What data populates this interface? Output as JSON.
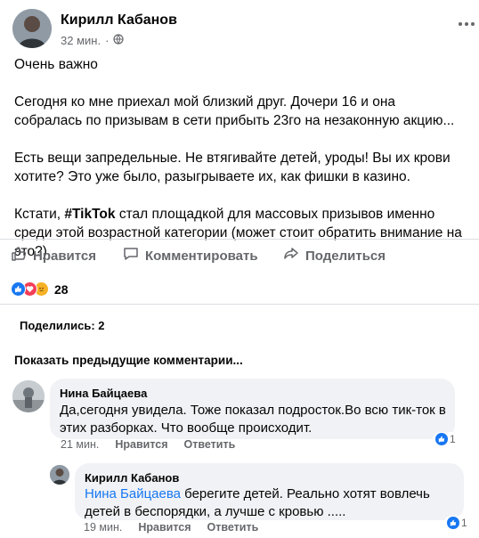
{
  "post": {
    "author": "Кирилл Кабанов",
    "time": "32 мин.",
    "dot": "·",
    "paragraphs": [
      "Очень важно",
      "Сегодня ко мне приехал мой близкий друг. Дочери 16 и она собралась по призывам в сети прибыть 23го на незаконную акцию...",
      "Есть вещи запредельные. Не втягивайте детей, уроды! Вы их крови хотите? Это уже было, разыгрываете их, как фишки в казино."
    ],
    "last_paragraph": {
      "before": "Кстати, ",
      "tag": "#TikTok",
      "after": " стал площадкой для массовых призывов именно среди этой возрастной категории (может стоит обратить внимание на это?)"
    }
  },
  "actions": {
    "like": "Нравится",
    "comment": "Комментировать",
    "share": "Поделиться"
  },
  "reactions": {
    "count": "28",
    "types": [
      "like",
      "love",
      "sad"
    ]
  },
  "shares_text": "Поделились: 2",
  "previous_comments": "Показать предыдущие комментарии...",
  "comments": [
    {
      "name": "Нина Байцаева",
      "text": "Да,сегодня увидела. Тоже показал подросток.Во всю тик-ток в этих разборках. Что вообще происходит.",
      "time": "21 мин.",
      "like": "Нравится",
      "reply": "Ответить",
      "likes": "1"
    },
    {
      "name": "Кирилл Кабанов",
      "mention": "Нина Байцаева",
      "text": " берегите детей. Реально хотят вовлечь детей в беспорядки, а лучше с кровью .....",
      "time": "19 мин.",
      "like": "Нравится",
      "reply": "Ответить",
      "likes": "1"
    }
  ],
  "colors": {
    "accent": "#1877f2",
    "love": "#f33e58",
    "sad": "#f7b125",
    "secondary_text": "#65676b",
    "bubble": "#f0f2f5"
  }
}
